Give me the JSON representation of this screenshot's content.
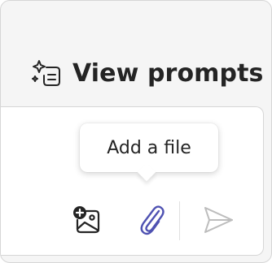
{
  "header": {
    "view_prompts_label": "View prompts",
    "view_prompts_icon": "sparkle-prompt-icon"
  },
  "tooltip": {
    "text": "Add a file"
  },
  "toolbar": {
    "add_image_icon": "add-image-icon",
    "attach_icon": "paperclip-icon",
    "send_icon": "send-icon"
  },
  "colors": {
    "accent": "#4f52b2",
    "text": "#242424",
    "send_disabled": "#bdbdbd"
  }
}
